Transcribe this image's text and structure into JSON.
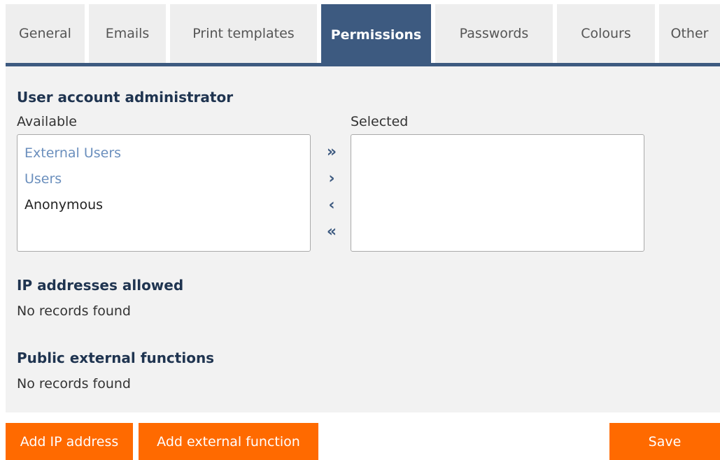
{
  "tabs": [
    {
      "label": "General",
      "active": false
    },
    {
      "label": "Emails",
      "active": false
    },
    {
      "label": "Print templates",
      "active": false
    },
    {
      "label": "Permissions",
      "active": true
    },
    {
      "label": "Passwords",
      "active": false
    },
    {
      "label": "Colours",
      "active": false
    },
    {
      "label": "Other",
      "active": false
    }
  ],
  "user_admin": {
    "title": "User account administrator",
    "available_label": "Available",
    "selected_label": "Selected",
    "available_items": [
      "External Users",
      "Users",
      "Anonymous"
    ],
    "selected_items": [],
    "move_buttons": {
      "add_all": "»",
      "add": "›",
      "remove": "‹",
      "remove_all": "«"
    }
  },
  "ip_addresses": {
    "title": "IP addresses allowed",
    "empty_text": "No records found"
  },
  "external_functions": {
    "title": "Public external functions",
    "empty_text": "No records found"
  },
  "actions": {
    "add_ip": "Add IP address",
    "add_function": "Add external function",
    "save": "Save"
  },
  "colors": {
    "accent": "#3d5a80",
    "button": "#ff6a00",
    "link_item": "#6b8fbd",
    "panel_bg": "#f2f2f2"
  }
}
